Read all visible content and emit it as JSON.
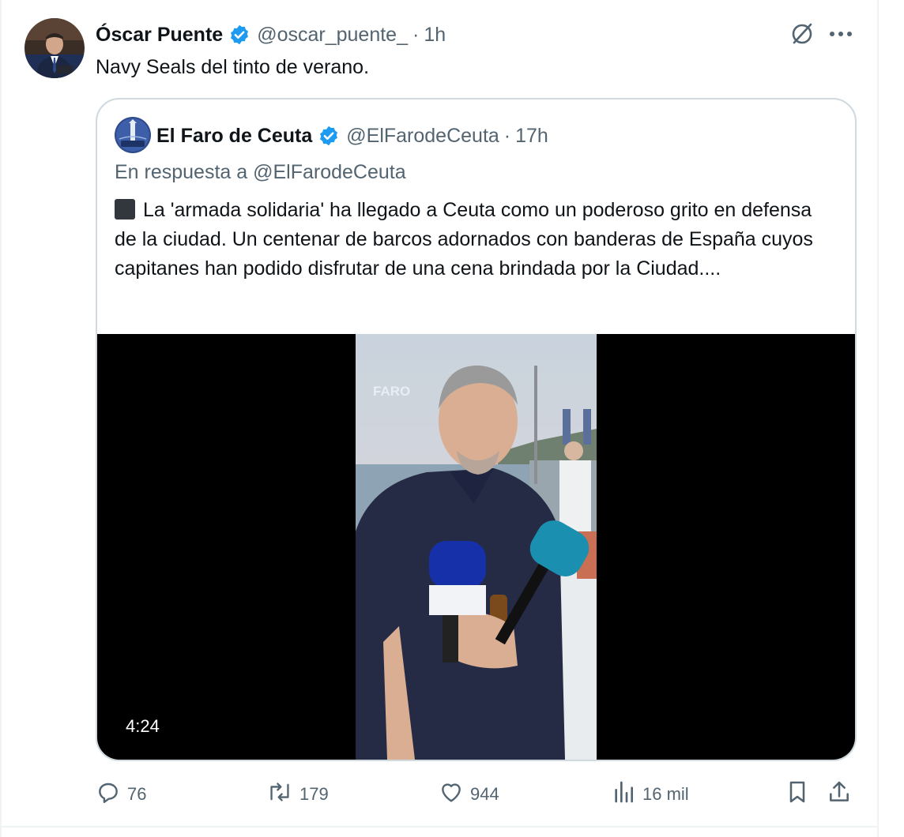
{
  "tweet": {
    "author_name": "Óscar Puente",
    "handle": "@oscar_puente_",
    "separator": "·",
    "time": "1h",
    "text": "Navy Seals del tinto de verano."
  },
  "quote": {
    "author_name": "El Faro de Ceuta",
    "handle": "@ElFarodeCeuta",
    "separator": "·",
    "time": "17h",
    "reply_to": "En respuesta a @ElFarodeCeuta",
    "text": "La 'armada solidaria' ha llegado a Ceuta como un poderoso grito en defensa de la ciudad. Un centenar de barcos adornados con banderas de España cuyos capitanes han podido disfrutar de una cena brindada por la Ciudad....",
    "video": {
      "duration": "4:24",
      "watermark": "FARO"
    }
  },
  "actions": {
    "replies": "76",
    "reposts": "179",
    "likes": "944",
    "views": "16 mil"
  },
  "icons": {
    "verified": "verified-badge-icon",
    "grok": "grok-icon",
    "more": "more-icon",
    "reply": "reply-icon",
    "repost": "repost-icon",
    "like": "like-icon",
    "views": "views-icon",
    "bookmark": "bookmark-icon",
    "share": "share-icon"
  },
  "colors": {
    "text_primary": "#0f1419",
    "text_secondary": "#536471",
    "verified_blue": "#1d9bf0",
    "border": "#cfd9de"
  }
}
